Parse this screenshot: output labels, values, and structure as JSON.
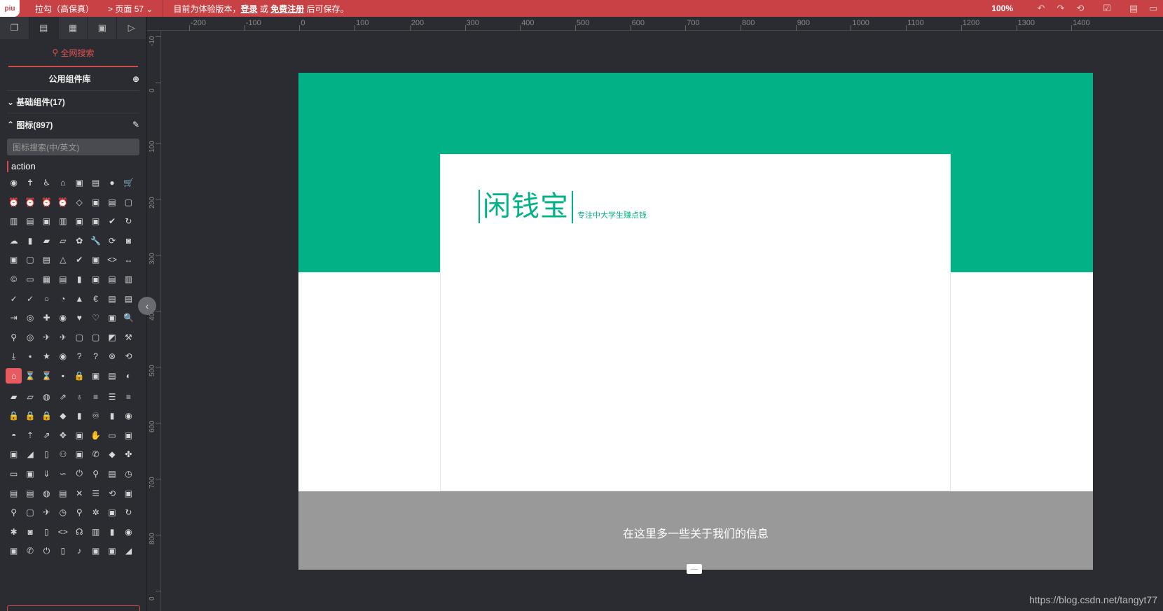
{
  "topbar": {
    "logo": "piu",
    "project": "拉勾（高保真）",
    "page": "> 页面 57",
    "notice_prefix": "目前为体验版本，",
    "login": "登录",
    "or": "或",
    "register": "免费注册",
    "notice_suffix": "后可保存。",
    "zoom": "100%"
  },
  "sidebar": {
    "search_all": "全网搜索",
    "public_library": "公用组件库",
    "basic_components": "基础组件(17)",
    "icons_section": "图标(897)",
    "icon_search_placeholder": "图标搜索(中/英文)",
    "category": "action",
    "icon_glyphs": [
      "◉",
      "✝",
      "♿",
      "⌂",
      "▣",
      "▤",
      "●",
      "🛒",
      "⏰",
      "⏰",
      "⏰",
      "⏰",
      "◇",
      "▣",
      "▤",
      "▢",
      "▥",
      "▤",
      "▣",
      "▥",
      "▣",
      "▣",
      "✔",
      "↻",
      "☁",
      "▮",
      "▰",
      "▱",
      "✿",
      "🔧",
      "⟳",
      "◙",
      "▣",
      "▢",
      "▤",
      "△",
      "✔",
      "▣",
      "<>",
      "↔",
      "©",
      "▭",
      "▦",
      "▤",
      "▮",
      "▣",
      "▤",
      "▥",
      "✓",
      "✓",
      "○",
      "◔",
      "▲",
      "€",
      "▤",
      "▤",
      "⇥",
      "◎",
      "✚",
      "◉",
      "♥",
      "♡",
      "▣",
      "🔍",
      "⚲",
      "◎",
      "✈",
      "✈",
      "▢",
      "▢",
      "◩",
      "⚒",
      "⤓",
      "▪",
      "★",
      "◉",
      "?",
      "?",
      "⊗",
      "⟲",
      "⌂",
      "⌛",
      "⌛",
      "▪",
      "🔒",
      "▣",
      "▤",
      "◐",
      "▰",
      "▱",
      "◍",
      "⇗",
      "♁",
      "≡",
      "☰",
      "≡",
      "🔒",
      "🔒",
      "🔒",
      "◆",
      "▮",
      "♾",
      "▮",
      "◉",
      "◓",
      "⇡",
      "⇗",
      "✥",
      "▣",
      "✋",
      "▭",
      "▣",
      "▣",
      "◢",
      "▯",
      "⚇",
      "▣",
      "✆",
      "◆",
      "✤",
      "▭",
      "▣",
      "⇓",
      "∽",
      "⏻",
      "⚲",
      "▤",
      "◷",
      "▤",
      "▤",
      "◍",
      "▤",
      "✕",
      "☰",
      "⟲",
      "▣",
      "⚲",
      "▢",
      "✈",
      "◷",
      "⚲",
      "✲",
      "▣",
      "↻",
      "✱",
      "◙",
      "▯",
      "<>",
      "☊",
      "▥",
      "▮",
      "◉",
      "▣",
      "✆",
      "⏻",
      "▯",
      "♪",
      "▣",
      "▣",
      "◢"
    ],
    "selected_icon_index": 80
  },
  "ruler": {
    "top_labels": [
      "-200",
      "-100",
      "0",
      "100",
      "200",
      "300",
      "400",
      "500",
      "600",
      "700",
      "800",
      "900",
      "1000",
      "1100",
      "1200",
      "1300",
      "1400"
    ],
    "left_labels": [
      "-10",
      "0",
      "100",
      "200",
      "300",
      "400",
      "500",
      "600",
      "700",
      "800",
      "0"
    ]
  },
  "design": {
    "brand_name": "闲钱宝",
    "slogan": "专注中大学生赚点钱",
    "footer_text": "在这里多一些关于我们的信息",
    "hero_color": "#03b187",
    "footer_color": "#999999"
  },
  "watermark": "https://blog.csdn.net/tangyt77"
}
